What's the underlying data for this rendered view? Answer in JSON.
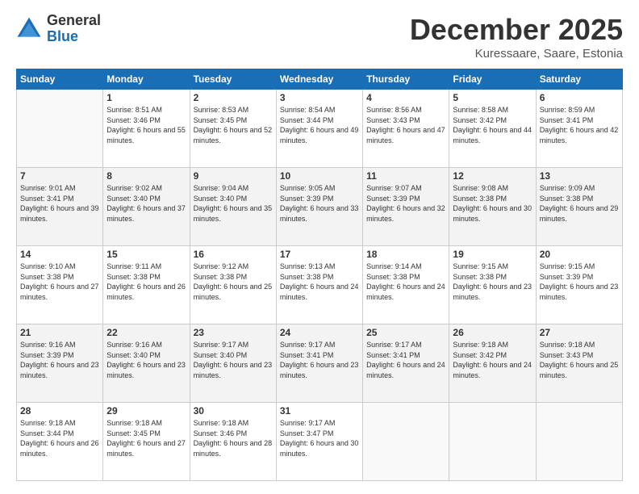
{
  "logo": {
    "general": "General",
    "blue": "Blue"
  },
  "header": {
    "month": "December 2025",
    "location": "Kuressaare, Saare, Estonia"
  },
  "weekdays": [
    "Sunday",
    "Monday",
    "Tuesday",
    "Wednesday",
    "Thursday",
    "Friday",
    "Saturday"
  ],
  "weeks": [
    [
      {
        "day": "",
        "empty": true
      },
      {
        "day": "1",
        "sunrise": "8:51 AM",
        "sunset": "3:46 PM",
        "daylight": "6 hours and 55 minutes."
      },
      {
        "day": "2",
        "sunrise": "8:53 AM",
        "sunset": "3:45 PM",
        "daylight": "6 hours and 52 minutes."
      },
      {
        "day": "3",
        "sunrise": "8:54 AM",
        "sunset": "3:44 PM",
        "daylight": "6 hours and 49 minutes."
      },
      {
        "day": "4",
        "sunrise": "8:56 AM",
        "sunset": "3:43 PM",
        "daylight": "6 hours and 47 minutes."
      },
      {
        "day": "5",
        "sunrise": "8:58 AM",
        "sunset": "3:42 PM",
        "daylight": "6 hours and 44 minutes."
      },
      {
        "day": "6",
        "sunrise": "8:59 AM",
        "sunset": "3:41 PM",
        "daylight": "6 hours and 42 minutes."
      }
    ],
    [
      {
        "day": "7",
        "sunrise": "9:01 AM",
        "sunset": "3:41 PM",
        "daylight": "6 hours and 39 minutes."
      },
      {
        "day": "8",
        "sunrise": "9:02 AM",
        "sunset": "3:40 PM",
        "daylight": "6 hours and 37 minutes."
      },
      {
        "day": "9",
        "sunrise": "9:04 AM",
        "sunset": "3:40 PM",
        "daylight": "6 hours and 35 minutes."
      },
      {
        "day": "10",
        "sunrise": "9:05 AM",
        "sunset": "3:39 PM",
        "daylight": "6 hours and 33 minutes."
      },
      {
        "day": "11",
        "sunrise": "9:07 AM",
        "sunset": "3:39 PM",
        "daylight": "6 hours and 32 minutes."
      },
      {
        "day": "12",
        "sunrise": "9:08 AM",
        "sunset": "3:38 PM",
        "daylight": "6 hours and 30 minutes."
      },
      {
        "day": "13",
        "sunrise": "9:09 AM",
        "sunset": "3:38 PM",
        "daylight": "6 hours and 29 minutes."
      }
    ],
    [
      {
        "day": "14",
        "sunrise": "9:10 AM",
        "sunset": "3:38 PM",
        "daylight": "6 hours and 27 minutes."
      },
      {
        "day": "15",
        "sunrise": "9:11 AM",
        "sunset": "3:38 PM",
        "daylight": "6 hours and 26 minutes."
      },
      {
        "day": "16",
        "sunrise": "9:12 AM",
        "sunset": "3:38 PM",
        "daylight": "6 hours and 25 minutes."
      },
      {
        "day": "17",
        "sunrise": "9:13 AM",
        "sunset": "3:38 PM",
        "daylight": "6 hours and 24 minutes."
      },
      {
        "day": "18",
        "sunrise": "9:14 AM",
        "sunset": "3:38 PM",
        "daylight": "6 hours and 24 minutes."
      },
      {
        "day": "19",
        "sunrise": "9:15 AM",
        "sunset": "3:38 PM",
        "daylight": "6 hours and 23 minutes."
      },
      {
        "day": "20",
        "sunrise": "9:15 AM",
        "sunset": "3:39 PM",
        "daylight": "6 hours and 23 minutes."
      }
    ],
    [
      {
        "day": "21",
        "sunrise": "9:16 AM",
        "sunset": "3:39 PM",
        "daylight": "6 hours and 23 minutes."
      },
      {
        "day": "22",
        "sunrise": "9:16 AM",
        "sunset": "3:40 PM",
        "daylight": "6 hours and 23 minutes."
      },
      {
        "day": "23",
        "sunrise": "9:17 AM",
        "sunset": "3:40 PM",
        "daylight": "6 hours and 23 minutes."
      },
      {
        "day": "24",
        "sunrise": "9:17 AM",
        "sunset": "3:41 PM",
        "daylight": "6 hours and 23 minutes."
      },
      {
        "day": "25",
        "sunrise": "9:17 AM",
        "sunset": "3:41 PM",
        "daylight": "6 hours and 24 minutes."
      },
      {
        "day": "26",
        "sunrise": "9:18 AM",
        "sunset": "3:42 PM",
        "daylight": "6 hours and 24 minutes."
      },
      {
        "day": "27",
        "sunrise": "9:18 AM",
        "sunset": "3:43 PM",
        "daylight": "6 hours and 25 minutes."
      }
    ],
    [
      {
        "day": "28",
        "sunrise": "9:18 AM",
        "sunset": "3:44 PM",
        "daylight": "6 hours and 26 minutes."
      },
      {
        "day": "29",
        "sunrise": "9:18 AM",
        "sunset": "3:45 PM",
        "daylight": "6 hours and 27 minutes."
      },
      {
        "day": "30",
        "sunrise": "9:18 AM",
        "sunset": "3:46 PM",
        "daylight": "6 hours and 28 minutes."
      },
      {
        "day": "31",
        "sunrise": "9:17 AM",
        "sunset": "3:47 PM",
        "daylight": "6 hours and 30 minutes."
      },
      {
        "day": "",
        "empty": true
      },
      {
        "day": "",
        "empty": true
      },
      {
        "day": "",
        "empty": true
      }
    ]
  ]
}
